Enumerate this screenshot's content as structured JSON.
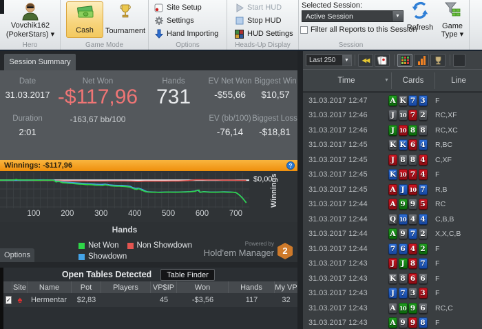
{
  "ribbon": {
    "hero": {
      "name": "Vovchik162",
      "site": "(PokerStars) ▾",
      "group": "Hero"
    },
    "game_mode": {
      "cash": "Cash",
      "tournament": "Tournament",
      "group": "Game Mode"
    },
    "options": {
      "site_setup": "Site Setup",
      "settings": "Settings",
      "hand_importing": "Hand Importing",
      "group": "Options"
    },
    "hud": {
      "start": "Start HUD",
      "stop": "Stop HUD",
      "settings": "HUD Settings",
      "group": "Heads-Up Display"
    },
    "session": {
      "label": "Selected Session:",
      "value": "Active Session",
      "filter": "Filter all Reports to this Session",
      "group": "Session",
      "refresh": "Refresh",
      "game_type": "Game Type ▾"
    }
  },
  "summary": {
    "tab": "Session Summary",
    "date_label": "Date",
    "date": "31.03.2017",
    "net_won_label": "Net Won",
    "net_won": "-$117,96",
    "net_won_bb": "-163,67 bb/100",
    "hands_label": "Hands",
    "hands": "731",
    "ev_net_won_label": "EV Net Won",
    "ev_net_won": "-$55,66",
    "biggest_win_label": "Biggest Win",
    "biggest_win": "$10,57",
    "duration_label": "Duration",
    "duration": "2:01",
    "ev_bb_label": "EV (bb/100)",
    "ev_bb": "-76,14",
    "biggest_loss_label": "Biggest Loss",
    "biggest_loss": "-$18,81",
    "net_won_color": "#ef7575"
  },
  "winnings_bar": {
    "text": "Winnings: -$117,96",
    "help": "?"
  },
  "chart_data": {
    "type": "line",
    "title": "Winnings: -$117,96",
    "xlabel": "Hands",
    "ylabel": "Winnings",
    "zero_label": "$0,00",
    "xticks": [
      100,
      200,
      300,
      400,
      500,
      600,
      700
    ],
    "xlim": [
      0,
      740
    ],
    "ylim": [
      40,
      -145
    ],
    "grid": true,
    "legend_position": "bottom",
    "legend": [
      {
        "label": "Net Won",
        "color": "#2ed648"
      },
      {
        "label": "Non Showdown",
        "color": "#e35550"
      },
      {
        "label": "Showdown",
        "color": "#44a4e8"
      }
    ],
    "series": [
      {
        "name": "Non Showdown",
        "color": "#e35550",
        "points": [
          [
            0,
            0
          ],
          [
            40,
            0
          ],
          [
            80,
            0
          ],
          [
            120,
            -1
          ],
          [
            150,
            0
          ],
          [
            162,
            -3
          ],
          [
            175,
            -3
          ],
          [
            190,
            -4
          ],
          [
            210,
            -4
          ],
          [
            230,
            -4
          ],
          [
            250,
            -4
          ],
          [
            270,
            -5
          ],
          [
            290,
            -5
          ],
          [
            310,
            -5
          ],
          [
            330,
            -4
          ],
          [
            350,
            -4
          ],
          [
            370,
            -4
          ],
          [
            390,
            -5
          ],
          [
            410,
            -6
          ],
          [
            430,
            -5
          ],
          [
            450,
            -5
          ],
          [
            470,
            -5
          ],
          [
            490,
            -5
          ],
          [
            510,
            -4
          ],
          [
            530,
            -4
          ],
          [
            548,
            -3
          ],
          [
            560,
            -2
          ],
          [
            572,
            0
          ],
          [
            582,
            2
          ],
          [
            592,
            2
          ],
          [
            602,
            2
          ],
          [
            615,
            1
          ],
          [
            630,
            1
          ],
          [
            645,
            1
          ],
          [
            660,
            0
          ],
          [
            675,
            0
          ],
          [
            690,
            0
          ],
          [
            705,
            -1
          ],
          [
            720,
            -1
          ],
          [
            731,
            -1
          ]
        ]
      },
      {
        "name": "Showdown",
        "color": "#44a4e8",
        "points": [
          [
            0,
            0
          ],
          [
            60,
            0
          ],
          [
            100,
            0
          ],
          [
            130,
            2
          ],
          [
            140,
            1
          ],
          [
            152,
            1
          ],
          [
            160,
            0
          ],
          [
            166,
            -5
          ],
          [
            175,
            -5
          ],
          [
            185,
            -9
          ],
          [
            195,
            -10
          ],
          [
            210,
            -12
          ],
          [
            225,
            -14
          ],
          [
            240,
            -16
          ],
          [
            255,
            -18
          ],
          [
            270,
            -19
          ],
          [
            285,
            -21
          ],
          [
            300,
            -22
          ],
          [
            312,
            -20
          ],
          [
            325,
            -24
          ],
          [
            338,
            -26
          ],
          [
            350,
            -27
          ],
          [
            362,
            -27
          ],
          [
            375,
            -29
          ],
          [
            386,
            -31
          ],
          [
            394,
            -38
          ],
          [
            402,
            -42
          ],
          [
            410,
            -41
          ],
          [
            418,
            -45
          ],
          [
            425,
            -50
          ],
          [
            432,
            -56
          ],
          [
            440,
            -60
          ],
          [
            455,
            -61
          ],
          [
            470,
            -62
          ],
          [
            490,
            -61
          ],
          [
            510,
            -61
          ],
          [
            530,
            -61
          ],
          [
            550,
            -60
          ],
          [
            565,
            -59
          ],
          [
            578,
            -56
          ],
          [
            587,
            -51
          ],
          [
            594,
            -62
          ],
          [
            605,
            -59
          ],
          [
            625,
            -61
          ],
          [
            645,
            -61
          ],
          [
            665,
            -60
          ],
          [
            685,
            -61
          ],
          [
            700,
            -63
          ],
          [
            710,
            -75
          ],
          [
            718,
            -88
          ],
          [
            726,
            -105
          ],
          [
            731,
            -116
          ]
        ]
      },
      {
        "name": "Net Won",
        "color": "#2ed648",
        "points": [
          [
            0,
            0
          ],
          [
            25,
            1
          ],
          [
            40,
            1
          ],
          [
            48,
            4
          ],
          [
            52,
            2
          ],
          [
            70,
            1
          ],
          [
            90,
            1
          ],
          [
            105,
            0
          ],
          [
            118,
            -1
          ],
          [
            128,
            1
          ],
          [
            138,
            0
          ],
          [
            152,
            0
          ],
          [
            160,
            -1
          ],
          [
            166,
            -9
          ],
          [
            172,
            -7
          ],
          [
            178,
            -8
          ],
          [
            185,
            -13
          ],
          [
            195,
            -14
          ],
          [
            205,
            -16
          ],
          [
            215,
            -17
          ],
          [
            225,
            -19
          ],
          [
            235,
            -20
          ],
          [
            245,
            -21
          ],
          [
            255,
            -23
          ],
          [
            265,
            -23
          ],
          [
            275,
            -24
          ],
          [
            285,
            -26
          ],
          [
            295,
            -26
          ],
          [
            305,
            -27
          ],
          [
            312,
            -24
          ],
          [
            320,
            -26
          ],
          [
            328,
            -29
          ],
          [
            336,
            -30
          ],
          [
            345,
            -31
          ],
          [
            355,
            -31
          ],
          [
            362,
            -32
          ],
          [
            370,
            -33
          ],
          [
            378,
            -34
          ],
          [
            386,
            -36
          ],
          [
            394,
            -42
          ],
          [
            400,
            -46
          ],
          [
            406,
            -48
          ],
          [
            411,
            -44
          ],
          [
            416,
            -47
          ],
          [
            421,
            -52
          ],
          [
            427,
            -56
          ],
          [
            433,
            -60
          ],
          [
            440,
            -61
          ],
          [
            450,
            -62
          ],
          [
            462,
            -62
          ],
          [
            475,
            -63
          ],
          [
            488,
            -62
          ],
          [
            500,
            -61
          ],
          [
            512,
            -62
          ],
          [
            525,
            -62
          ],
          [
            538,
            -61
          ],
          [
            550,
            -61
          ],
          [
            562,
            -60
          ],
          [
            572,
            -59
          ],
          [
            580,
            -57
          ],
          [
            587,
            -52
          ],
          [
            591,
            -51
          ],
          [
            594,
            -63
          ],
          [
            598,
            -61
          ],
          [
            605,
            -60
          ],
          [
            615,
            -61
          ],
          [
            625,
            -62
          ],
          [
            635,
            -62
          ],
          [
            645,
            -62
          ],
          [
            655,
            -61
          ],
          [
            665,
            -61
          ],
          [
            675,
            -62
          ],
          [
            685,
            -62
          ],
          [
            693,
            -62
          ],
          [
            700,
            -64
          ],
          [
            705,
            -69
          ],
          [
            710,
            -76
          ],
          [
            714,
            -82
          ],
          [
            718,
            -89
          ],
          [
            722,
            -97
          ],
          [
            726,
            -106
          ],
          [
            729,
            -112
          ],
          [
            731,
            -117
          ]
        ]
      }
    ]
  },
  "branding": {
    "powered": "Powered by",
    "name": "Hold'em Manager",
    "badge": "2"
  },
  "options_button": "Options",
  "open_tables": {
    "title": "Open Tables Detected",
    "finder": "Table Finder",
    "columns": [
      "Site",
      "Name",
      "Pot",
      "Players",
      "VP$IP",
      "Won",
      "Hands",
      "My VP"
    ],
    "rows": [
      {
        "checked": "✓",
        "site_icon": "pokerstars-spade",
        "name": "Hermentar",
        "pot": "$2,83",
        "players": "",
        "vpsip": "45",
        "won": "-$3,56",
        "hands": "117",
        "my_vp": "32"
      }
    ]
  },
  "right_panel": {
    "range": "Last 250",
    "columns": [
      "Time",
      "Cards",
      "Line"
    ],
    "suit_colors": {
      "c": [
        "#21a021",
        "#0b640b"
      ],
      "s": [
        "#74787d",
        "#3a3e43"
      ],
      "d": [
        "#2f70d8",
        "#15439a"
      ],
      "h": [
        "#d01622",
        "#870c13"
      ]
    },
    "rows": [
      {
        "time": "31.03.2017 12:47",
        "cards": [
          [
            "A",
            "c"
          ],
          [
            "K",
            "s"
          ],
          [
            "7",
            "d"
          ],
          [
            "3",
            "d"
          ]
        ],
        "line": "F"
      },
      {
        "time": "31.03.2017 12:46",
        "cards": [
          [
            "J",
            "s"
          ],
          [
            "10",
            "s"
          ],
          [
            "7",
            "h"
          ],
          [
            "2",
            "s"
          ]
        ],
        "line": "RC,XF"
      },
      {
        "time": "31.03.2017 12:46",
        "cards": [
          [
            "J",
            "c"
          ],
          [
            "10",
            "h"
          ],
          [
            "8",
            "c"
          ],
          [
            "8",
            "s"
          ]
        ],
        "line": "RC,XC"
      },
      {
        "time": "31.03.2017 12:45",
        "cards": [
          [
            "K",
            "s"
          ],
          [
            "K",
            "d"
          ],
          [
            "6",
            "h"
          ],
          [
            "4",
            "d"
          ]
        ],
        "line": "R,BC"
      },
      {
        "time": "31.03.2017 12:45",
        "cards": [
          [
            "J",
            "h"
          ],
          [
            "8",
            "s"
          ],
          [
            "8",
            "s"
          ],
          [
            "4",
            "h"
          ]
        ],
        "line": "C,XF"
      },
      {
        "time": "31.03.2017 12:45",
        "cards": [
          [
            "K",
            "d"
          ],
          [
            "10",
            "h"
          ],
          [
            "7",
            "h"
          ],
          [
            "4",
            "h"
          ]
        ],
        "line": "F"
      },
      {
        "time": "31.03.2017 12:45",
        "cards": [
          [
            "A",
            "h"
          ],
          [
            "J",
            "d"
          ],
          [
            "10",
            "h"
          ],
          [
            "7",
            "d"
          ]
        ],
        "line": "R,B"
      },
      {
        "time": "31.03.2017 12:44",
        "cards": [
          [
            "A",
            "h"
          ],
          [
            "9",
            "c"
          ],
          [
            "9",
            "s"
          ],
          [
            "5",
            "h"
          ]
        ],
        "line": "RC"
      },
      {
        "time": "31.03.2017 12:44",
        "cards": [
          [
            "Q",
            "s"
          ],
          [
            "10",
            "d"
          ],
          [
            "4",
            "s"
          ],
          [
            "4",
            "d"
          ]
        ],
        "line": "C,B,B"
      },
      {
        "time": "31.03.2017 12:44",
        "cards": [
          [
            "A",
            "c"
          ],
          [
            "9",
            "s"
          ],
          [
            "7",
            "d"
          ],
          [
            "2",
            "s"
          ]
        ],
        "line": "X,X,C,B"
      },
      {
        "time": "31.03.2017 12:44",
        "cards": [
          [
            "7",
            "d"
          ],
          [
            "6",
            "d"
          ],
          [
            "4",
            "h"
          ],
          [
            "2",
            "c"
          ]
        ],
        "line": "F"
      },
      {
        "time": "31.03.2017 12:43",
        "cards": [
          [
            "J",
            "h"
          ],
          [
            "J",
            "c"
          ],
          [
            "8",
            "h"
          ],
          [
            "7",
            "d"
          ]
        ],
        "line": "F"
      },
      {
        "time": "31.03.2017 12:43",
        "cards": [
          [
            "K",
            "s"
          ],
          [
            "8",
            "s"
          ],
          [
            "6",
            "h"
          ],
          [
            "6",
            "s"
          ]
        ],
        "line": "F"
      },
      {
        "time": "31.03.2017 12:43",
        "cards": [
          [
            "J",
            "d"
          ],
          [
            "7",
            "d"
          ],
          [
            "3",
            "s"
          ],
          [
            "3",
            "h"
          ]
        ],
        "line": "F"
      },
      {
        "time": "31.03.2017 12:43",
        "cards": [
          [
            "A",
            "s"
          ],
          [
            "10",
            "c"
          ],
          [
            "9",
            "c"
          ],
          [
            "6",
            "s"
          ]
        ],
        "line": "RC,C"
      },
      {
        "time": "31.03.2017 12:43",
        "cards": [
          [
            "A",
            "c"
          ],
          [
            "9",
            "s"
          ],
          [
            "9",
            "h"
          ],
          [
            "8",
            "d"
          ]
        ],
        "line": "F"
      }
    ]
  }
}
